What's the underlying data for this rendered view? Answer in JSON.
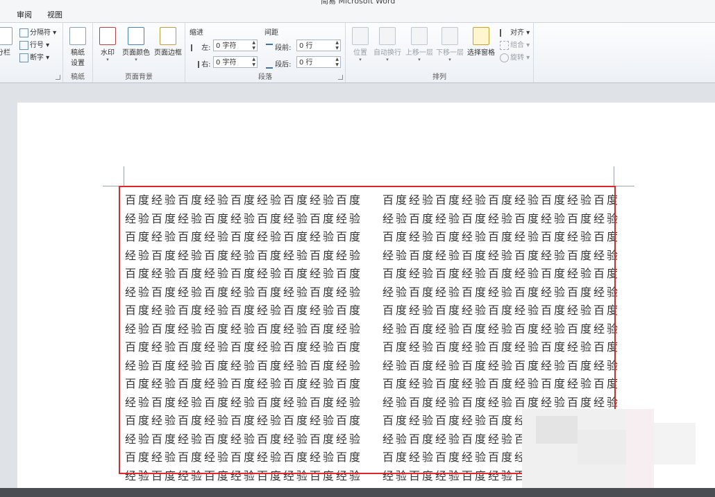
{
  "window": {
    "title": "简易 Microsoft Word"
  },
  "tabs": [
    "审阅",
    "视图"
  ],
  "ribbon": {
    "columns_group": {
      "columns_label": "分栏",
      "breaks_label": "分隔符",
      "line_numbers_label": "行号",
      "hyphenation_label": "断字"
    },
    "manuscript_group": {
      "button_label_line1": "稿纸",
      "button_label_line2": "设置",
      "group_label": "稿纸"
    },
    "page_background_group": {
      "watermark_label": "水印",
      "page_color_label": "页面颜色",
      "page_borders_label": "页面边框",
      "group_label": "页面背景"
    },
    "paragraph_group": {
      "indent_header": "缩进",
      "spacing_header": "间距",
      "left_label": "左:",
      "right_label": "右:",
      "left_value": "0 字符",
      "right_value": "0 字符",
      "before_label": "段前:",
      "after_label": "段后:",
      "before_value": "0 行",
      "after_value": "0 行",
      "group_label": "段落"
    },
    "arrange_group": {
      "position_label": "位置",
      "wrap_text_label": "自动换行",
      "bring_forward_label": "上移一层",
      "send_backward_label": "下移一层",
      "selection_pane_label": "选择窗格",
      "align_label": "对齐",
      "group_label_small": "组合",
      "rotate_label": "旋转",
      "group_label": "排列"
    }
  },
  "document": {
    "line_a": "百度经验百度经验百度经验百度经验百度",
    "line_b": "经验百度经验百度经验百度经验百度经验"
  },
  "colors": {
    "selection_border": "#e02727"
  }
}
